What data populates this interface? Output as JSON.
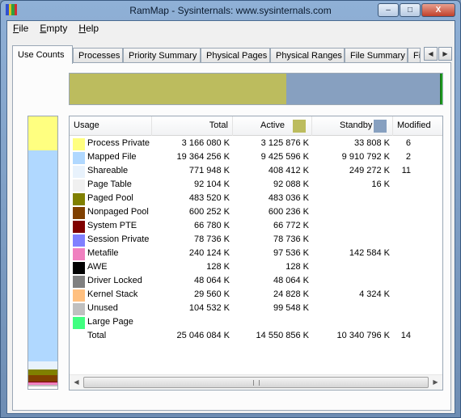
{
  "window": {
    "title": "RamMap - Sysinternals: www.sysinternals.com",
    "icon_name": "rammap-app-icon",
    "icon_colors": [
      "#3050d0",
      "#e0c020",
      "#30a040",
      "#d03030"
    ],
    "min_label": "–",
    "max_label": "□",
    "close_label": "X"
  },
  "menu": {
    "items": [
      {
        "mnemonic": "F",
        "rest": "ile"
      },
      {
        "mnemonic": "E",
        "rest": "mpty"
      },
      {
        "mnemonic": "H",
        "rest": "elp"
      }
    ]
  },
  "tabs": {
    "items": [
      {
        "label": "Use Counts",
        "active": true
      },
      {
        "label": "Processes"
      },
      {
        "label": "Priority Summary"
      },
      {
        "label": "Physical Pages"
      },
      {
        "label": "Physical Ranges"
      },
      {
        "label": "File Summary"
      },
      {
        "label": "Fil"
      }
    ],
    "scroll_left": "◀",
    "scroll_right": "▶"
  },
  "topbar": {
    "segments": [
      {
        "name": "active",
        "color": "#bcbc5e",
        "fraction": 0.581
      },
      {
        "name": "standby",
        "color": "#87a0c0",
        "fraction": 0.413
      },
      {
        "name": "modified",
        "color": "#1a7a1a",
        "fraction": 0.004
      },
      {
        "name": "free",
        "color": "#1fc01f",
        "fraction": 0.002
      }
    ]
  },
  "sidebar": {
    "segments": [
      {
        "name": "process-private",
        "color": "#ffff80",
        "fraction": 0.126
      },
      {
        "name": "mapped-file",
        "color": "#b0d8ff",
        "fraction": 0.773
      },
      {
        "name": "shareable",
        "color": "#e8f2fc",
        "fraction": 0.031
      },
      {
        "name": "paged-pool",
        "color": "#808000",
        "fraction": 0.019
      },
      {
        "name": "nonpaged-pool",
        "color": "#804000",
        "fraction": 0.024
      },
      {
        "name": "system-pte",
        "color": "#800000",
        "fraction": 0.003
      },
      {
        "name": "metafile",
        "color": "#f080c0",
        "fraction": 0.01
      },
      {
        "name": "unused",
        "color": "#c0c0c0",
        "fraction": 0.004
      },
      {
        "name": "other",
        "color": "#ffffff",
        "fraction": 0.01
      }
    ]
  },
  "listview": {
    "columns": [
      {
        "key": "usage",
        "label": "Usage",
        "width": 102,
        "align": "left"
      },
      {
        "key": "total",
        "label": "Total",
        "width": 100,
        "align": "right"
      },
      {
        "key": "active",
        "label": "Active",
        "width": 98,
        "align": "right",
        "swatch": "#bcbc5e"
      },
      {
        "key": "standby",
        "label": "Standby",
        "width": 100,
        "align": "right",
        "swatch": "#87a0c0"
      },
      {
        "key": "modified",
        "label": "Modified",
        "width": 120,
        "align": "left"
      }
    ],
    "rows": [
      {
        "usage": "Process Private",
        "color": "#ffff80",
        "total": "3 166 080 K",
        "active": "3 125 876 K",
        "standby": "33 808 K",
        "modified": "6"
      },
      {
        "usage": "Mapped File",
        "color": "#b0d8ff",
        "total": "19 364 256 K",
        "active": "9 425 596 K",
        "standby": "9 910 792 K",
        "modified": "2"
      },
      {
        "usage": "Shareable",
        "color": "#e8f2fc",
        "total": "771 948 K",
        "active": "408 412 K",
        "standby": "249 272 K",
        "modified": "11"
      },
      {
        "usage": "Page Table",
        "color": "#f0f0f0",
        "total": "92 104 K",
        "active": "92 088 K",
        "standby": "16 K",
        "modified": ""
      },
      {
        "usage": "Paged Pool",
        "color": "#808000",
        "total": "483 520 K",
        "active": "483 036 K",
        "standby": "",
        "modified": ""
      },
      {
        "usage": "Nonpaged Pool",
        "color": "#804000",
        "total": "600 252 K",
        "active": "600 236 K",
        "standby": "",
        "modified": ""
      },
      {
        "usage": "System PTE",
        "color": "#800000",
        "total": "66 780 K",
        "active": "66 772 K",
        "standby": "",
        "modified": ""
      },
      {
        "usage": "Session Private",
        "color": "#8080ff",
        "total": "78 736 K",
        "active": "78 736 K",
        "standby": "",
        "modified": ""
      },
      {
        "usage": "Metafile",
        "color": "#f080c0",
        "total": "240 124 K",
        "active": "97 536 K",
        "standby": "142 584 K",
        "modified": ""
      },
      {
        "usage": "AWE",
        "color": "#000000",
        "total": "128 K",
        "active": "128 K",
        "standby": "",
        "modified": ""
      },
      {
        "usage": "Driver Locked",
        "color": "#808080",
        "total": "48 064 K",
        "active": "48 064 K",
        "standby": "",
        "modified": ""
      },
      {
        "usage": "Kernel Stack",
        "color": "#ffc080",
        "total": "29 560 K",
        "active": "24 828 K",
        "standby": "4 324 K",
        "modified": ""
      },
      {
        "usage": "Unused",
        "color": "#c0c0c0",
        "total": "104 532 K",
        "active": "99 548 K",
        "standby": "",
        "modified": ""
      },
      {
        "usage": "Large Page",
        "color": "#40ff80",
        "total": "",
        "active": "",
        "standby": "",
        "modified": ""
      },
      {
        "usage": "Total",
        "color": "",
        "total": "25 046 084 K",
        "active": "14 550 856 K",
        "standby": "10 340 796 K",
        "modified": "14"
      }
    ]
  },
  "hscroll": {
    "left_arrow": "◀",
    "right_arrow": "▶",
    "position": 0
  }
}
